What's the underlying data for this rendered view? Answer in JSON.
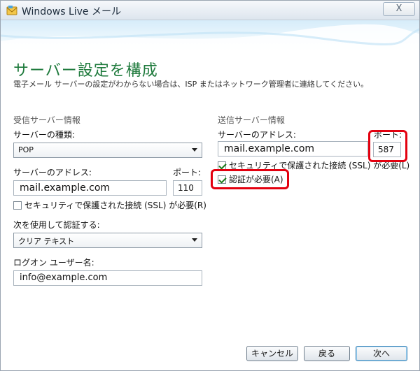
{
  "window": {
    "title": "Windows Live メール",
    "close_label": "X",
    "app_icon": "windows-live-mail-icon"
  },
  "header": {
    "title": "サーバー設定を構成",
    "description": "電子メール サーバーの設定がわからない場合は、ISP またはネットワーク管理者に連絡してください。"
  },
  "incoming": {
    "section_label": "受信サーバー情報",
    "server_type_label": "サーバーの種類:",
    "server_type_value": "POP",
    "address_label": "サーバーのアドレス:",
    "address_value": "mail.example.com",
    "port_label": "ポート:",
    "port_value": "110",
    "ssl_label": "セキュリティで保護された接続 (SSL) が必要(R)",
    "ssl_checked": false,
    "auth_label": "次を使用して認証する:",
    "auth_value": "クリア テキスト",
    "logon_label": "ログオン ユーザー名:",
    "logon_value": "info@example.com"
  },
  "outgoing": {
    "section_label": "送信サーバー情報",
    "address_label": "サーバーのアドレス:",
    "port_label": "ポート:",
    "address_value": "mail.example.com",
    "port_value": "587",
    "ssl_label": "セキュリティで保護された接続 (SSL) が必要(L)",
    "ssl_checked": true,
    "auth_required_label": "認証が必要(A)",
    "auth_required_checked": true
  },
  "buttons": {
    "cancel": "キャンセル",
    "back": "戻る",
    "next": "次へ"
  },
  "colors": {
    "title_green": "#1e7a3c",
    "highlight_red": "#e3000f"
  }
}
